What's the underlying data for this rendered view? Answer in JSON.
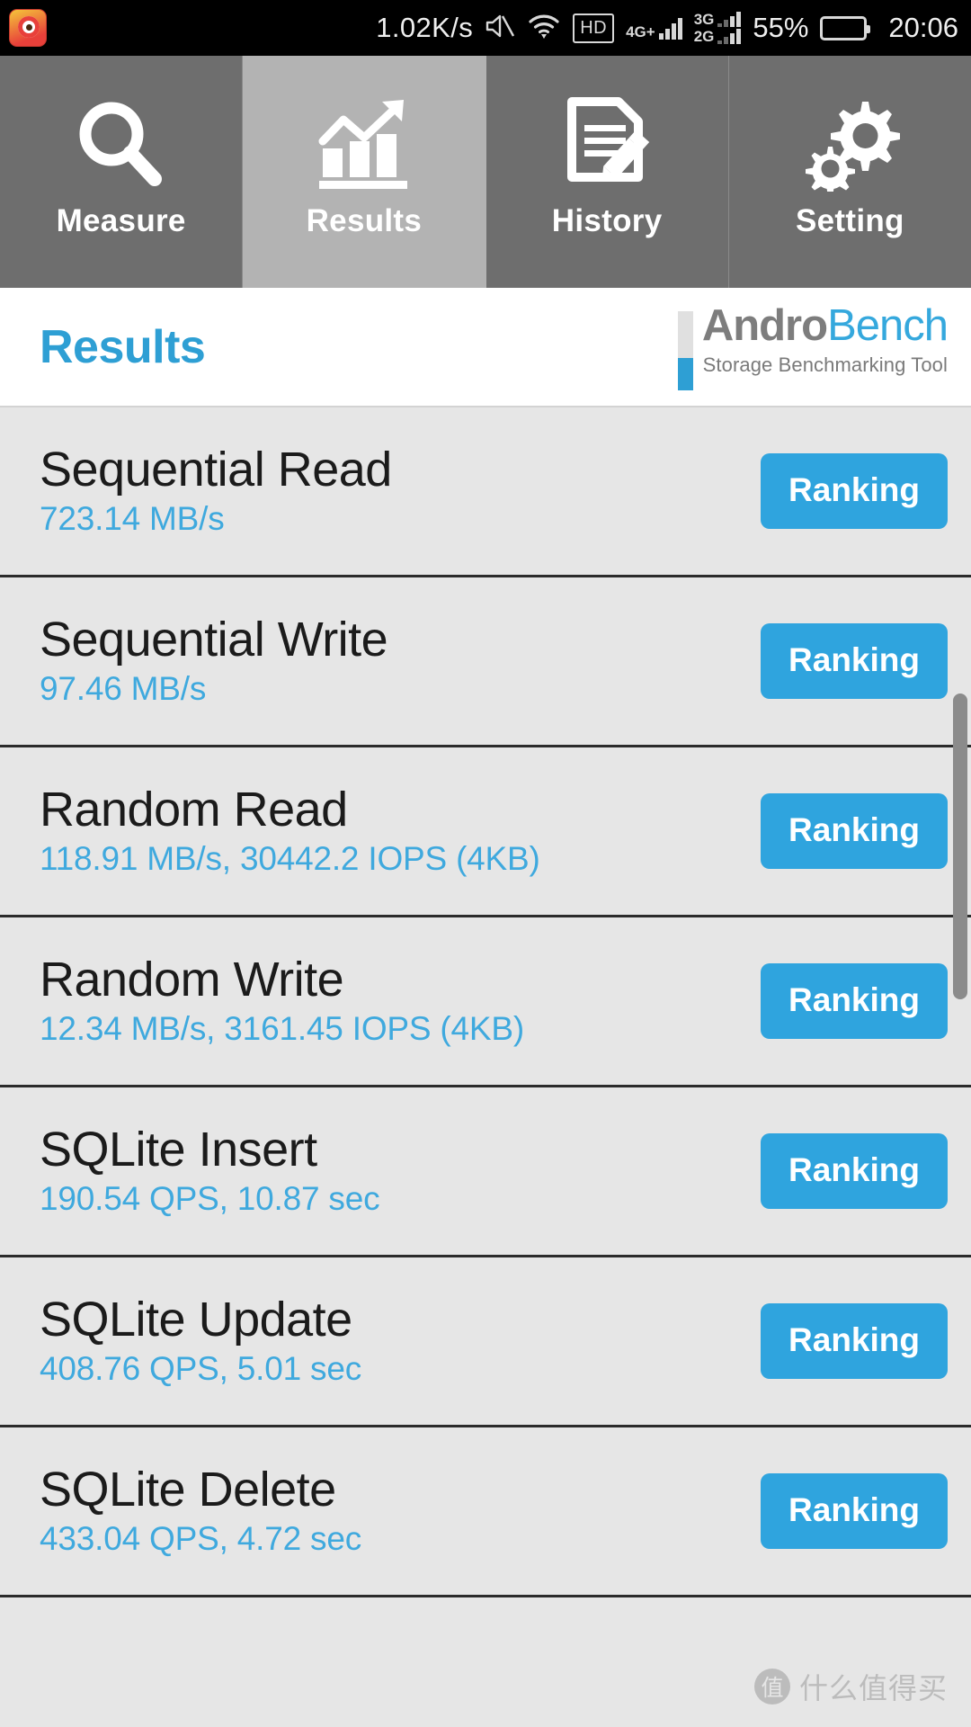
{
  "status_bar": {
    "app_icon": "weibo-app-icon",
    "network_speed": "1.02K/s",
    "mute_icon": "mute-icon",
    "wifi_icon": "wifi-icon",
    "hd_label": "HD",
    "sim1_label": "4G+",
    "sim2_label_top": "3G",
    "sim2_label_bottom": "2G",
    "battery_percent": "55%",
    "battery_level": 55,
    "time": "20:06"
  },
  "tabs": [
    {
      "label": "Measure",
      "icon": "magnifier-icon",
      "active": false
    },
    {
      "label": "Results",
      "icon": "bar-chart-icon",
      "active": true
    },
    {
      "label": "History",
      "icon": "document-pencil-icon",
      "active": false
    },
    {
      "label": "Setting",
      "icon": "gears-icon",
      "active": false
    }
  ],
  "header": {
    "title": "Results",
    "logo_andro": "Andro",
    "logo_bench": "Bench",
    "logo_tagline": "Storage Benchmarking Tool"
  },
  "results": [
    {
      "title": "Sequential Read",
      "value": "723.14 MB/s",
      "button": "Ranking"
    },
    {
      "title": "Sequential Write",
      "value": "97.46 MB/s",
      "button": "Ranking"
    },
    {
      "title": "Random Read",
      "value": "118.91 MB/s, 30442.2 IOPS (4KB)",
      "button": "Ranking"
    },
    {
      "title": "Random Write",
      "value": "12.34 MB/s, 3161.45 IOPS (4KB)",
      "button": "Ranking"
    },
    {
      "title": "SQLite Insert",
      "value": "190.54 QPS, 10.87 sec",
      "button": "Ranking"
    },
    {
      "title": "SQLite Update",
      "value": "408.76 QPS, 5.01 sec",
      "button": "Ranking"
    },
    {
      "title": "SQLite Delete",
      "value": "433.04 QPS, 4.72 sec",
      "button": "Ranking"
    }
  ],
  "watermark": {
    "logo_char": "值",
    "text": "什么值得买"
  },
  "colors": {
    "accent_blue": "#2fa4de",
    "value_blue": "#3fa9de",
    "tab_inactive": "#6e6e6e",
    "tab_active": "#b3b3b3",
    "list_bg": "#e6e6e6",
    "logo_gray": "#7d7d7d"
  }
}
